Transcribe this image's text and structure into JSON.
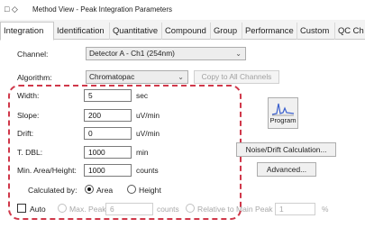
{
  "window": {
    "icons": "□ ◇",
    "title": "Method View - Peak Integration Parameters"
  },
  "tabs": [
    "Integration",
    "Identification",
    "Quantitative",
    "Compound",
    "Group",
    "Performance",
    "Custom",
    "QC Ch"
  ],
  "channel": {
    "label": "Channel:",
    "value": "Detector A - Ch1 (254nm)"
  },
  "algorithm": {
    "label": "Algorithm:",
    "value": "Chromatopac",
    "copy_button": "Copy to All Channels"
  },
  "params": [
    {
      "label": "Width:",
      "value": "5",
      "unit": "sec"
    },
    {
      "label": "Slope:",
      "value": "200",
      "unit": "uV/min"
    },
    {
      "label": "Drift:",
      "value": "0",
      "unit": "uV/min"
    },
    {
      "label": "T. DBL:",
      "value": "1000",
      "unit": "min"
    },
    {
      "label": "Min. Area/Height:",
      "value": "1000",
      "unit": "counts"
    }
  ],
  "calculated_by": {
    "label": "Calculated by:",
    "options": [
      "Area",
      "Height"
    ],
    "selected": "Area"
  },
  "program_button": "Program",
  "noise_button": "Noise/Drift Calculation...",
  "advanced_button": "Advanced...",
  "auto": {
    "label": "Auto",
    "max_peak_label": "Max. Peak",
    "max_peak_value": "6",
    "max_peak_unit": "counts",
    "relative_label": "Relative to Main Peak",
    "relative_value": "1",
    "relative_unit": "%"
  },
  "colors": {
    "highlight_border": "#d0384a",
    "program_icon": "#3a5fcd"
  }
}
